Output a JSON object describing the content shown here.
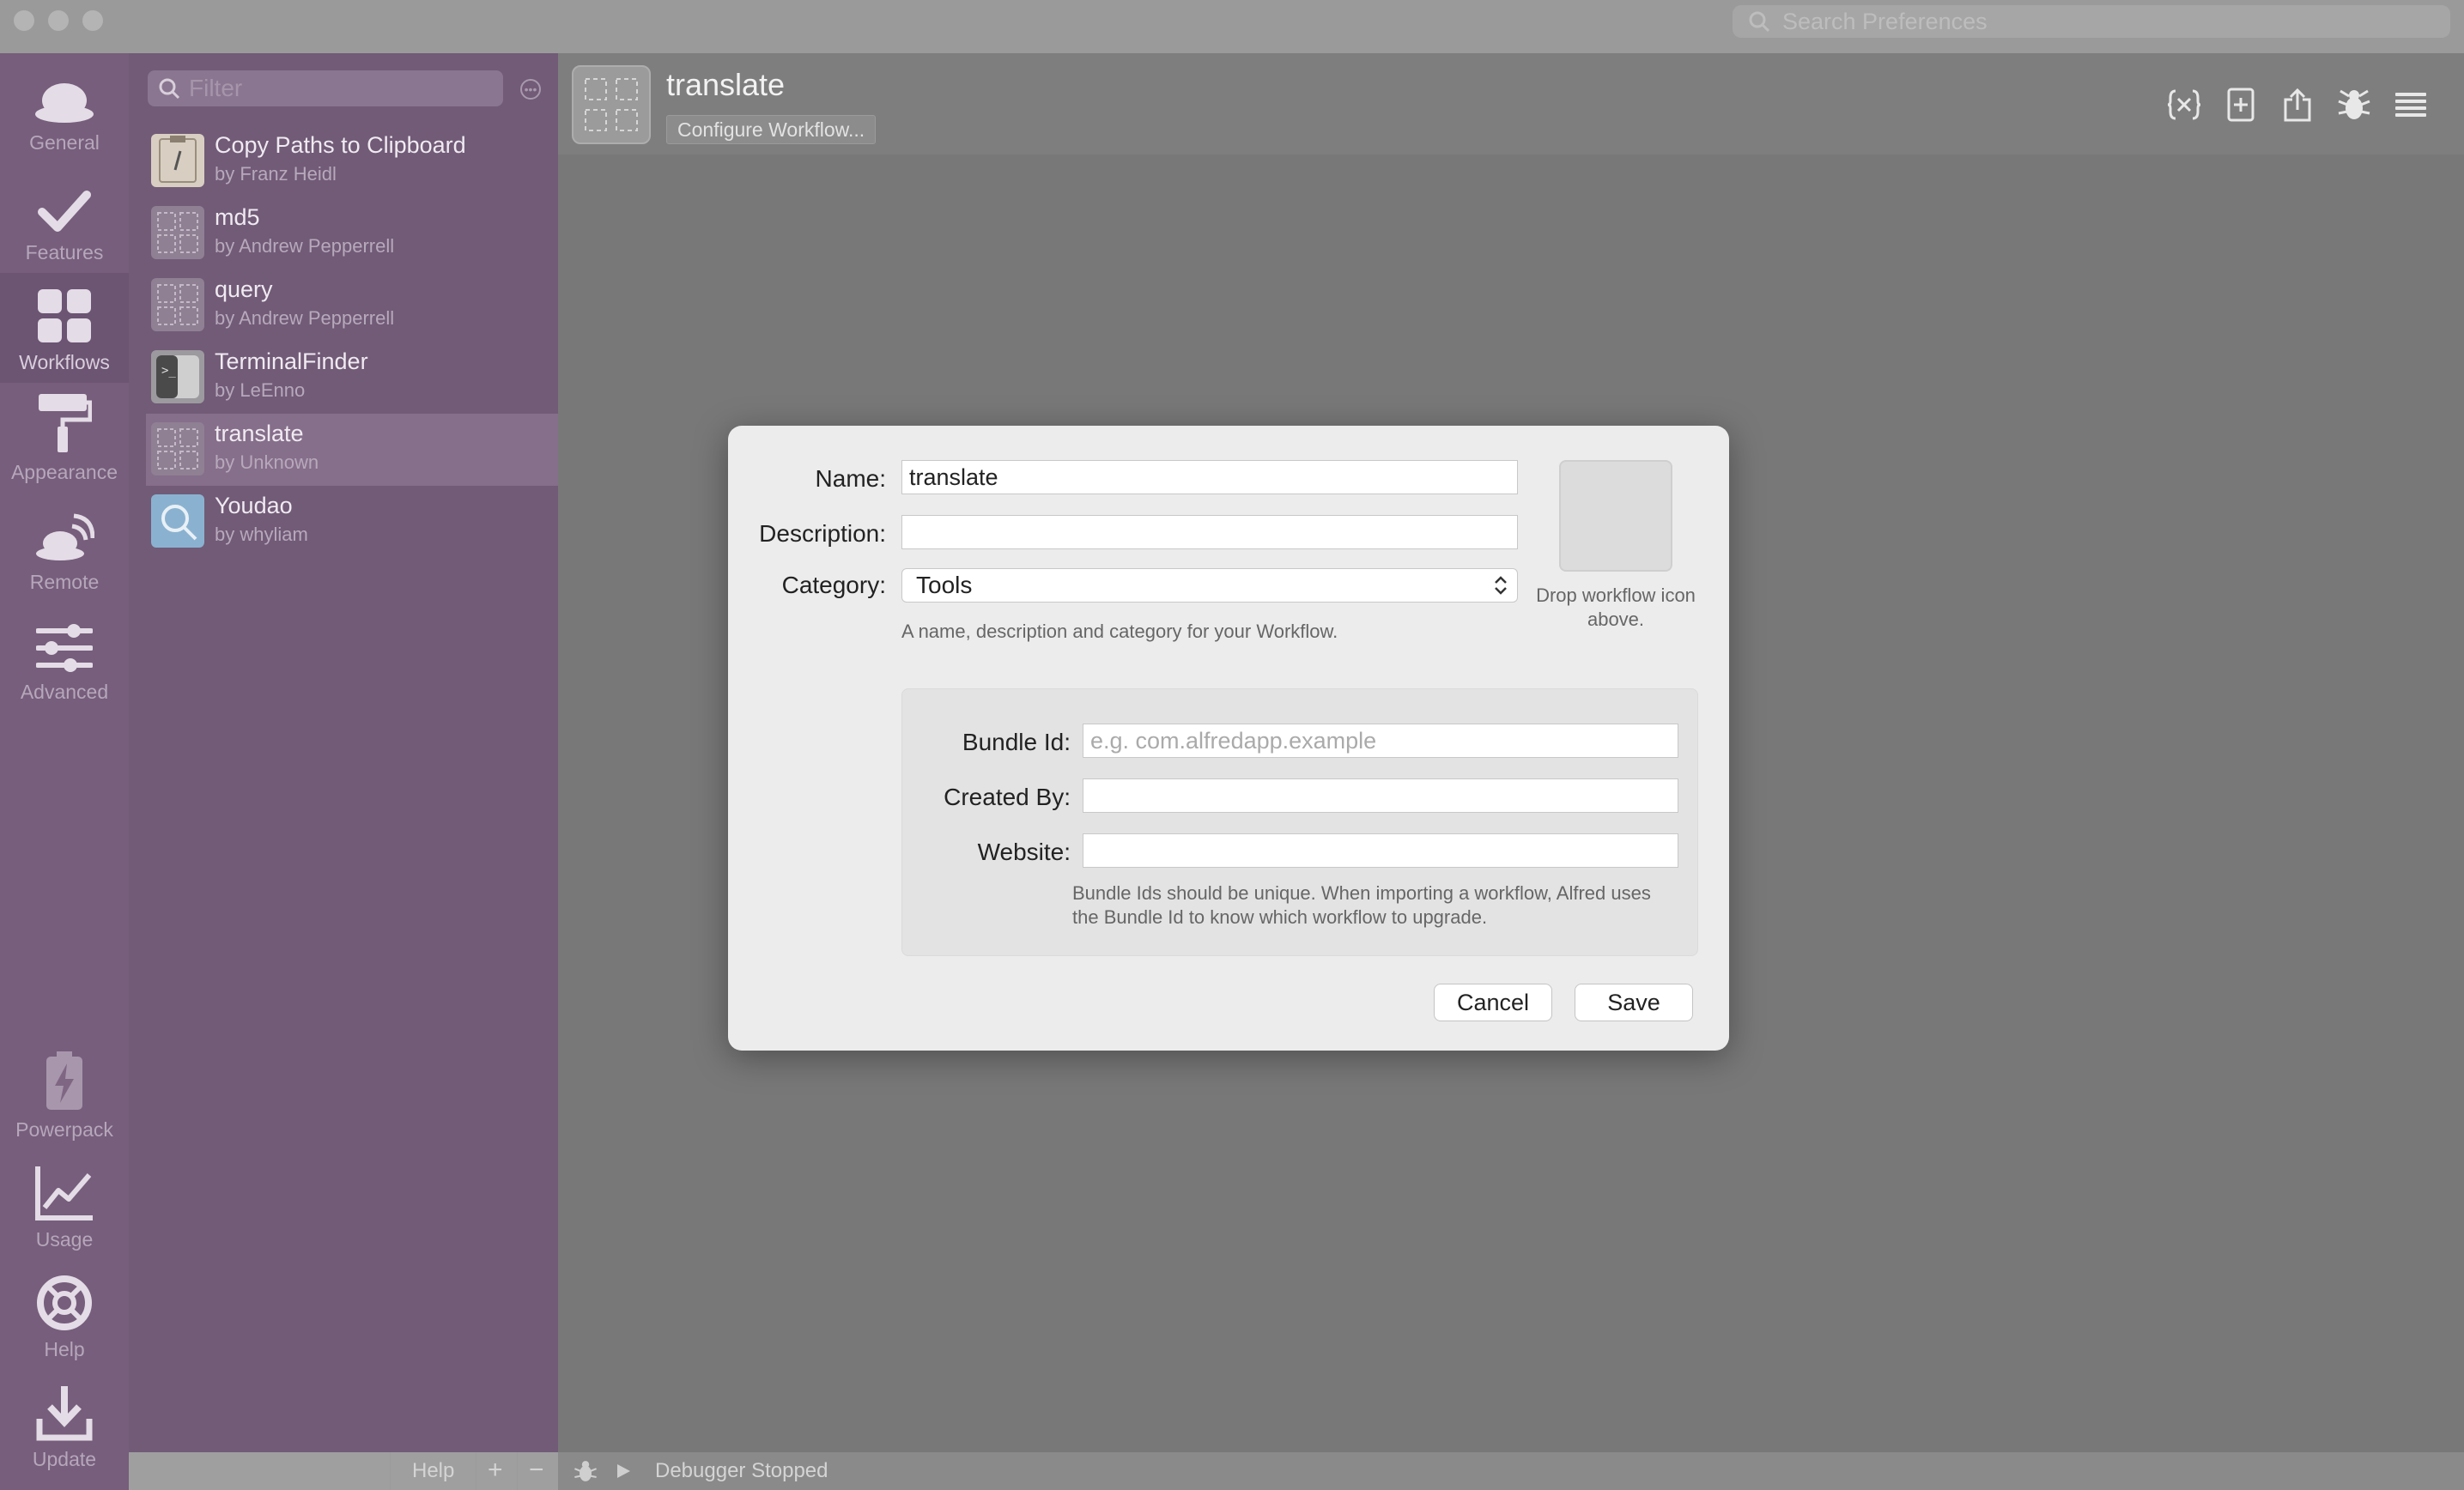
{
  "window": {
    "search_placeholder": "Search Preferences"
  },
  "nav": {
    "items": [
      {
        "label": "General"
      },
      {
        "label": "Features"
      },
      {
        "label": "Workflows"
      },
      {
        "label": "Appearance"
      },
      {
        "label": "Remote"
      },
      {
        "label": "Advanced"
      },
      {
        "label": "Powerpack"
      },
      {
        "label": "Usage"
      },
      {
        "label": "Help"
      },
      {
        "label": "Update"
      }
    ],
    "active": "Workflows"
  },
  "list": {
    "filter_placeholder": "Filter",
    "workflows": [
      {
        "title": "Copy Paths to Clipboard",
        "author": "by Franz Heidl"
      },
      {
        "title": "md5",
        "author": "by Andrew Pepperrell"
      },
      {
        "title": "query",
        "author": "by Andrew Pepperrell"
      },
      {
        "title": "TerminalFinder",
        "author": "by LeEnno"
      },
      {
        "title": "translate",
        "author": "by Unknown"
      },
      {
        "title": "Youdao",
        "author": "by whyliam"
      }
    ],
    "selected": "translate"
  },
  "main": {
    "workflow_name": "translate",
    "configure_label": "Configure Workflow..."
  },
  "status": {
    "help_label": "Help",
    "add_label": "+",
    "remove_label": "−",
    "debugger_text": "Debugger Stopped"
  },
  "dialog": {
    "name_label": "Name:",
    "name_value": "translate",
    "description_label": "Description:",
    "description_value": "",
    "category_label": "Category:",
    "category_value": "Tools",
    "hint": "A name, description and category for your Workflow.",
    "drop_hint": "Drop workflow icon above.",
    "bundle_label": "Bundle Id:",
    "bundle_placeholder": "e.g. com.alfredapp.example",
    "created_label": "Created By:",
    "created_value": "",
    "website_label": "Website:",
    "website_value": "",
    "bundle_hint": "Bundle Ids should be unique. When importing a workflow, Alfred uses the Bundle Id to know which workflow to upgrade.",
    "cancel_label": "Cancel",
    "save_label": "Save"
  }
}
